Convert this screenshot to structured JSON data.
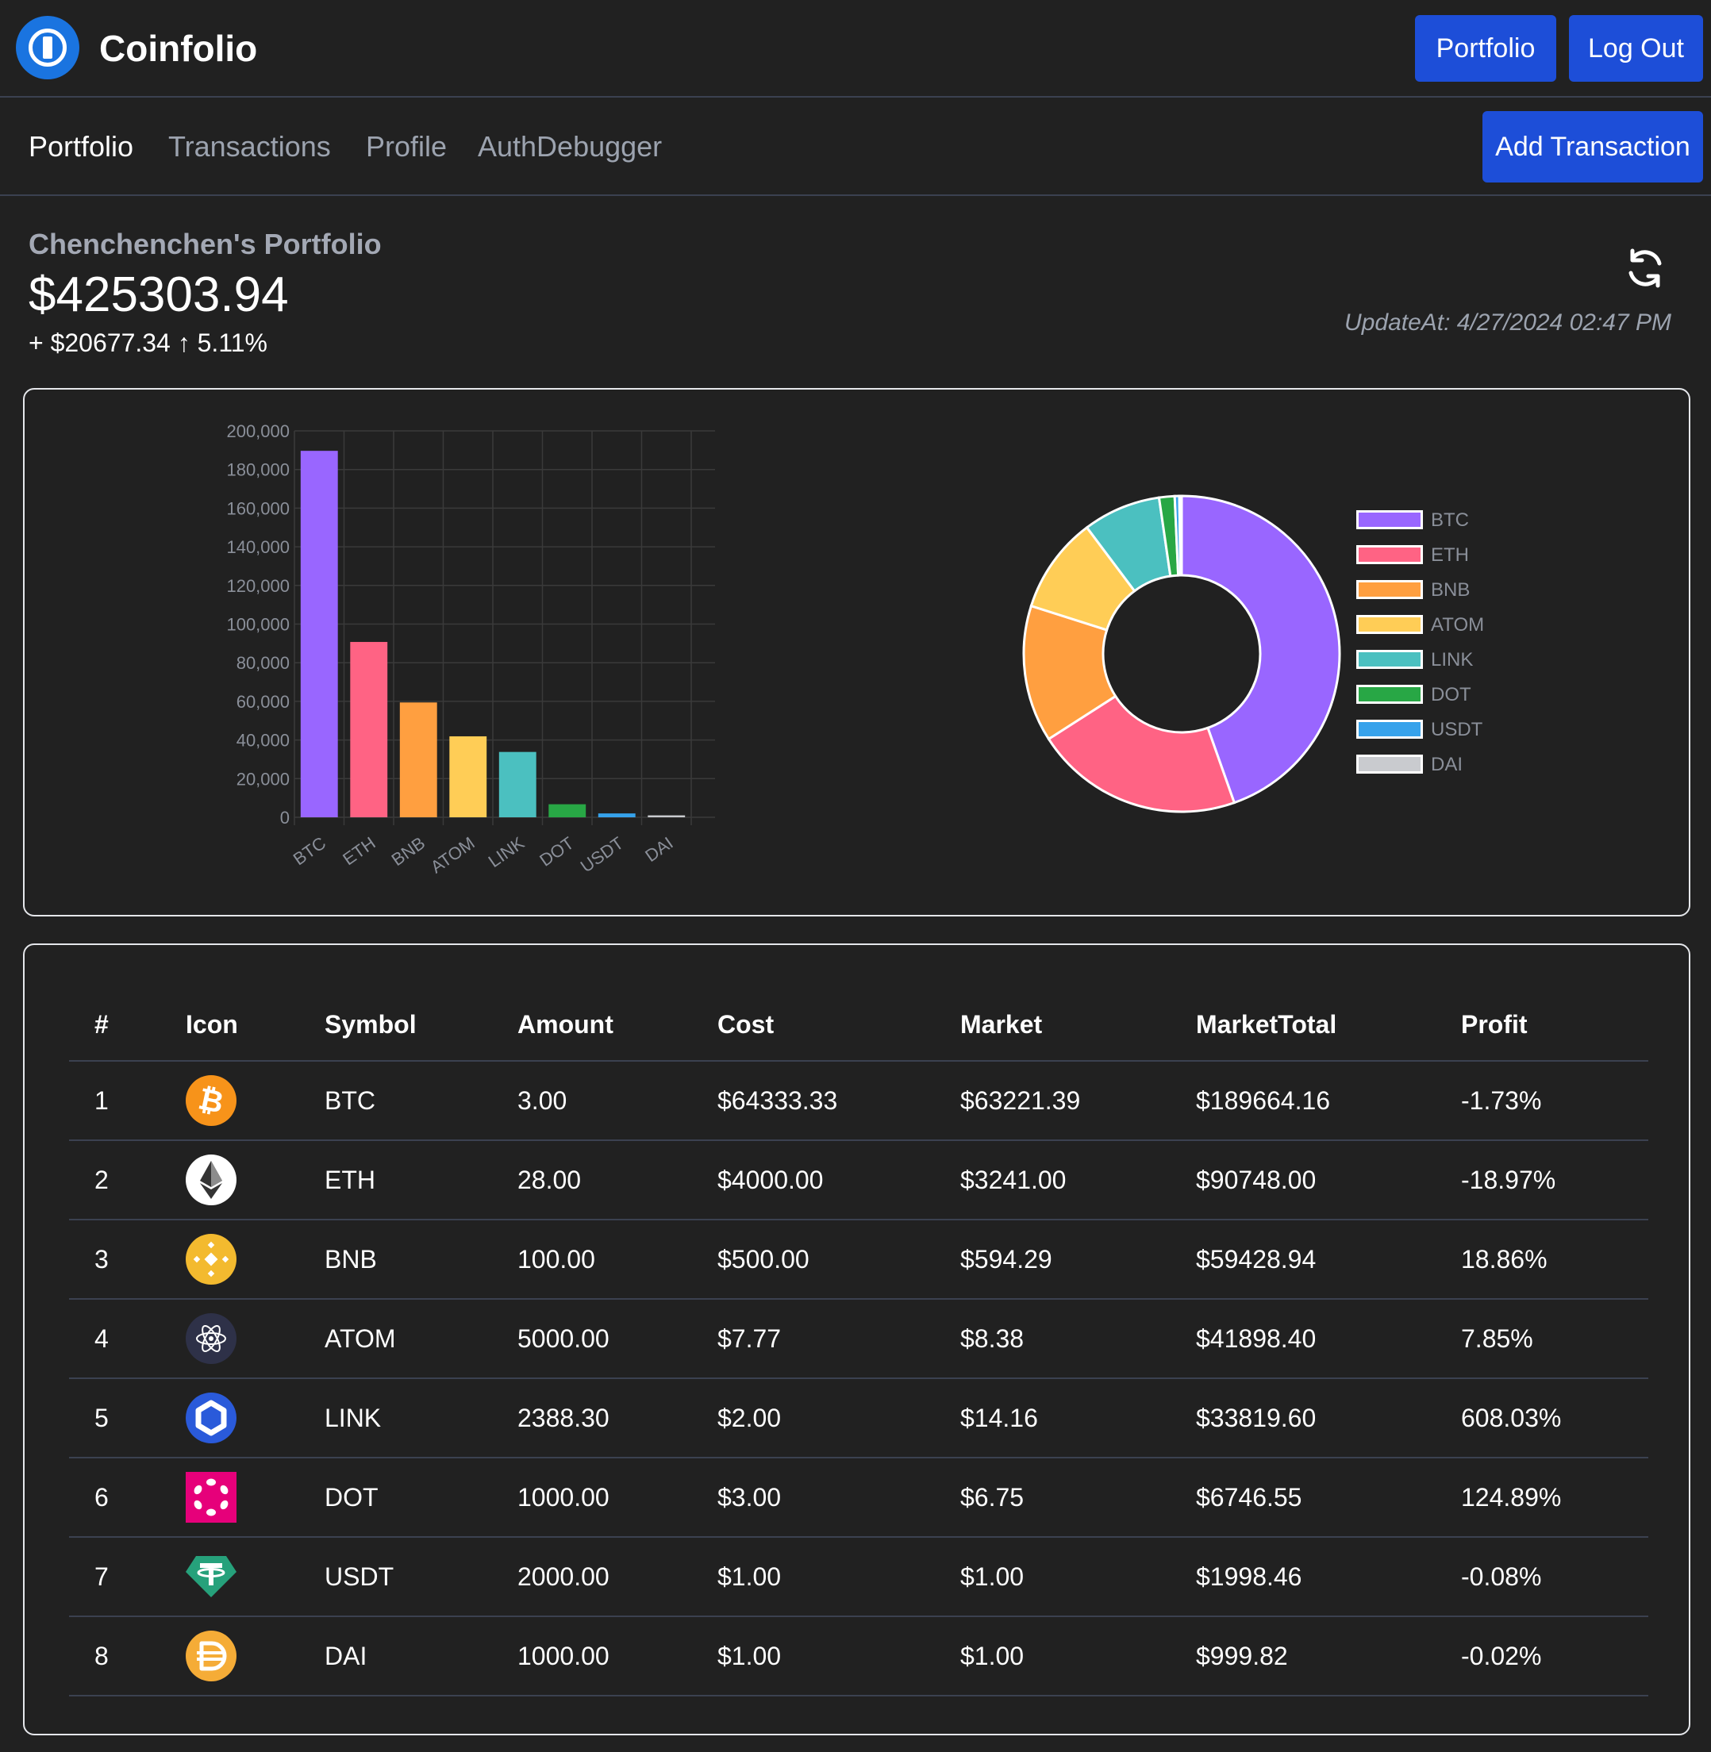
{
  "app": {
    "brand": "Coinfolio"
  },
  "header": {
    "portfolio_button": "Portfolio",
    "logout_button": "Log Out"
  },
  "subnav": {
    "links": [
      "Portfolio",
      "Transactions",
      "Profile",
      "AuthDebugger"
    ],
    "active": "Portfolio",
    "add_button": "Add Transaction"
  },
  "portfolio": {
    "owner_title": "Chenchenchen's Portfolio",
    "total_value": "$425303.94",
    "change_text": "+ $20677.34 ↑ 5.11%",
    "updated_at": "UpdateAt: 4/27/2024 02:47 PM",
    "refresh_icon": "refresh-icon"
  },
  "chart_data": [
    {
      "type": "bar",
      "categories": [
        "BTC",
        "ETH",
        "BNB",
        "ATOM",
        "LINK",
        "DOT",
        "USDT",
        "DAI"
      ],
      "values": [
        189664.16,
        90748.0,
        59428.94,
        41898.4,
        33819.6,
        6746.55,
        1998.46,
        999.82
      ],
      "colors": [
        "#9966ff",
        "#ff6384",
        "#ff9f40",
        "#ffcd56",
        "#4bc0c0",
        "#28a745",
        "#36a2eb",
        "#c9cbcf"
      ],
      "ylim": [
        0,
        200000
      ],
      "yticks": [
        "0",
        "20,000",
        "40,000",
        "60,000",
        "80,000",
        "100,000",
        "120,000",
        "140,000",
        "160,000",
        "180,000",
        "200,000"
      ],
      "grid": true,
      "legend": "none"
    },
    {
      "type": "pie",
      "style": "doughnut",
      "labels": [
        "BTC",
        "ETH",
        "BNB",
        "ATOM",
        "LINK",
        "DOT",
        "USDT",
        "DAI"
      ],
      "values": [
        189664.16,
        90748.0,
        59428.94,
        41898.4,
        33819.6,
        6746.55,
        1998.46,
        999.82
      ],
      "colors": [
        "#9966ff",
        "#ff6384",
        "#ff9f40",
        "#ffcd56",
        "#4bc0c0",
        "#28a745",
        "#36a2eb",
        "#c9cbcf"
      ],
      "legend": "right"
    }
  ],
  "table": {
    "headers": [
      "#",
      "Icon",
      "Symbol",
      "Amount",
      "Cost",
      "Market",
      "MarketTotal",
      "Profit"
    ],
    "rows": [
      {
        "index": "1",
        "icon": "btc-icon",
        "symbol": "BTC",
        "amount": "3.00",
        "cost": "$64333.33",
        "market": "$63221.39",
        "total": "$189664.16",
        "profit": "-1.73%"
      },
      {
        "index": "2",
        "icon": "eth-icon",
        "symbol": "ETH",
        "amount": "28.00",
        "cost": "$4000.00",
        "market": "$3241.00",
        "total": "$90748.00",
        "profit": "-18.97%"
      },
      {
        "index": "3",
        "icon": "bnb-icon",
        "symbol": "BNB",
        "amount": "100.00",
        "cost": "$500.00",
        "market": "$594.29",
        "total": "$59428.94",
        "profit": "18.86%"
      },
      {
        "index": "4",
        "icon": "atom-icon",
        "symbol": "ATOM",
        "amount": "5000.00",
        "cost": "$7.77",
        "market": "$8.38",
        "total": "$41898.40",
        "profit": "7.85%"
      },
      {
        "index": "5",
        "icon": "link-icon",
        "symbol": "LINK",
        "amount": "2388.30",
        "cost": "$2.00",
        "market": "$14.16",
        "total": "$33819.60",
        "profit": "608.03%"
      },
      {
        "index": "6",
        "icon": "dot-icon",
        "symbol": "DOT",
        "amount": "1000.00",
        "cost": "$3.00",
        "market": "$6.75",
        "total": "$6746.55",
        "profit": "124.89%"
      },
      {
        "index": "7",
        "icon": "usdt-icon",
        "symbol": "USDT",
        "amount": "2000.00",
        "cost": "$1.00",
        "market": "$1.00",
        "total": "$1998.46",
        "profit": "-0.08%"
      },
      {
        "index": "8",
        "icon": "dai-icon",
        "symbol": "DAI",
        "amount": "1000.00",
        "cost": "$1.00",
        "market": "$1.00",
        "total": "$999.82",
        "profit": "-0.02%"
      }
    ]
  }
}
